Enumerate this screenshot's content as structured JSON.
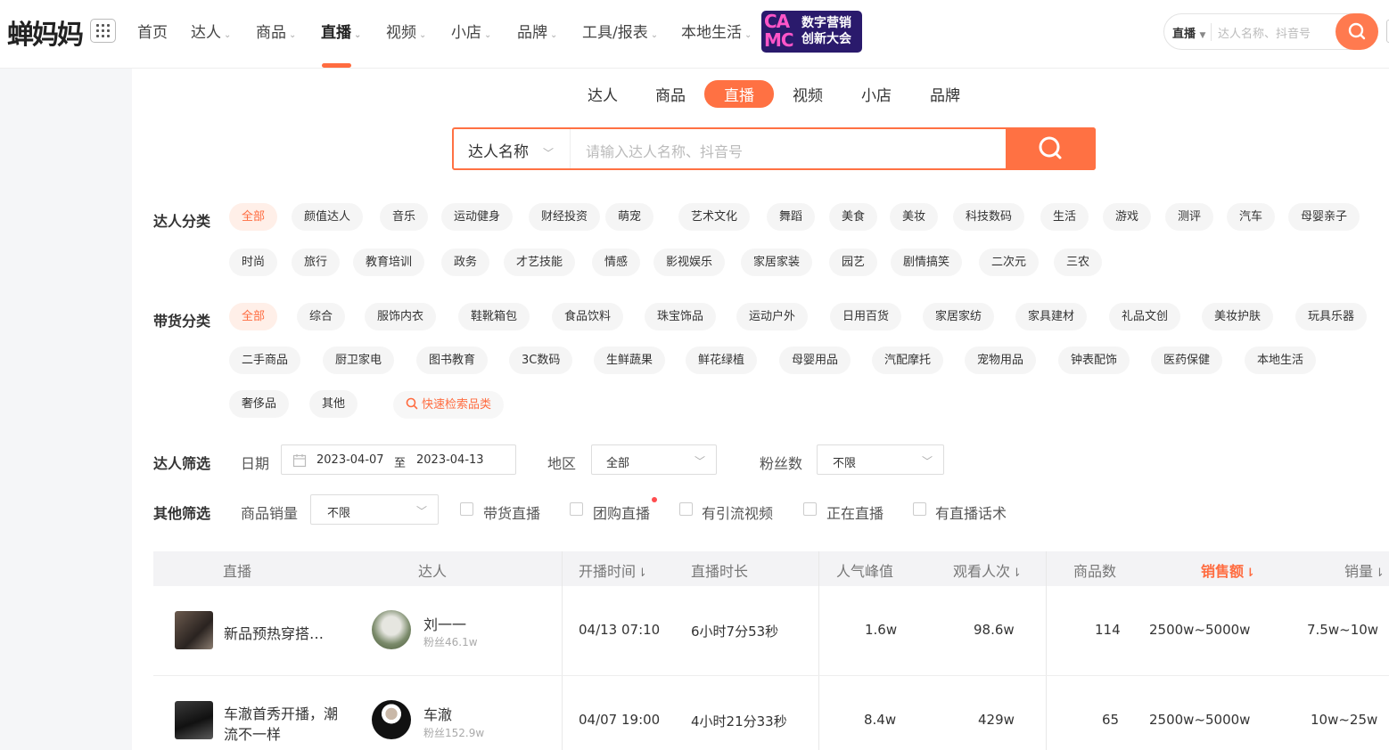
{
  "topnav": {
    "logo": "蝉妈妈",
    "items": [
      {
        "label": "首页",
        "caret": ""
      },
      {
        "label": "达人",
        "caret": "⌄"
      },
      {
        "label": "商品",
        "caret": "⌄"
      },
      {
        "label": "直播",
        "caret": "⌄"
      },
      {
        "label": "视频",
        "caret": "⌄"
      },
      {
        "label": "小店",
        "caret": "⌄"
      },
      {
        "label": "品牌",
        "caret": "⌄"
      },
      {
        "label": "工具/报表",
        "caret": "⌄"
      },
      {
        "label": "本地生活",
        "caret": "⌄"
      }
    ],
    "active_item": "直播",
    "badge_logo": "CA MC",
    "badge_text_1": "数字营销",
    "badge_text_2": "创新大会",
    "search_select": "直播",
    "search_placeholder": "达人名称、抖音号"
  },
  "subtabs": [
    "达人",
    "商品",
    "直播",
    "视频",
    "小店",
    "品牌"
  ],
  "active_subtab": "直播",
  "search": {
    "select": "达人名称",
    "placeholder": "请输入达人名称、抖音号"
  },
  "filters": {
    "talent_label": "达人分类",
    "talent_row1": [
      "全部",
      "颜值达人",
      "音乐",
      "运动健身",
      "财经投资",
      "萌宠",
      "艺术文化",
      "舞蹈",
      "美食",
      "美妆",
      "科技数码",
      "生活",
      "游戏",
      "测评",
      "汽车",
      "母婴亲子"
    ],
    "talent_row2": [
      "时尚",
      "旅行",
      "教育培训",
      "政务",
      "才艺技能",
      "情感",
      "影视娱乐",
      "家居家装",
      "园艺",
      "剧情搞笑",
      "二次元",
      "三农"
    ],
    "goods_label": "带货分类",
    "goods_row1": [
      "全部",
      "综合",
      "服饰内衣",
      "鞋靴箱包",
      "食品饮料",
      "珠宝饰品",
      "运动户外",
      "日用百货",
      "家居家纺",
      "家具建材",
      "礼品文创",
      "美妆护肤",
      "玩具乐器"
    ],
    "goods_row2": [
      "二手商品",
      "厨卫家电",
      "图书教育",
      "3C数码",
      "生鲜蔬果",
      "鲜花绿植",
      "母婴用品",
      "汽配摩托",
      "宠物用品",
      "钟表配饰",
      "医药保健",
      "本地生活"
    ],
    "goods_row3": [
      "奢侈品",
      "其他"
    ],
    "quick_search": "快速检索品类",
    "screen_label": "达人筛选",
    "date_label": "日期",
    "date_start": "2023-04-07",
    "date_to": "至",
    "date_end": "2023-04-13",
    "region_label": "地区",
    "region_value": "全部",
    "fans_label": "粉丝数",
    "fans_value": "不限",
    "other_label": "其他筛选",
    "sales_label": "商品销量",
    "sales_value": "不限",
    "checkboxes": [
      "带货直播",
      "团购直播",
      "有引流视频",
      "正在直播",
      "有直播话术"
    ]
  },
  "table": {
    "headers": {
      "live": "直播",
      "talent": "达人",
      "start_time": "开播时间",
      "duration": "直播时长",
      "peak": "人气峰值",
      "views": "观看人次",
      "goods": "商品数",
      "sales_amount": "销售额",
      "sales_volume": "销量"
    },
    "rows": [
      {
        "title": "新品预热穿搭…",
        "talent": "刘一一",
        "fans": "粉丝46.1w",
        "start": "04/13 07:10",
        "duration": "6小时7分53秒",
        "peak": "1.6w",
        "views": "98.6w",
        "goods": "114",
        "amount": "2500w~5000w",
        "volume": "7.5w~10w"
      },
      {
        "title": "车澈首秀开播，潮\n流不一样",
        "title_l1": "车澈首秀开播，潮",
        "title_l2": "流不一样",
        "talent": "车澈",
        "fans": "粉丝152.9w",
        "start": "04/07 19:00",
        "duration": "4小时21分33秒",
        "peak": "8.4w",
        "views": "429w",
        "goods": "65",
        "amount": "2500w~5000w",
        "volume": "10w~25w"
      }
    ]
  },
  "colors": {
    "accent": "#ff7143"
  }
}
